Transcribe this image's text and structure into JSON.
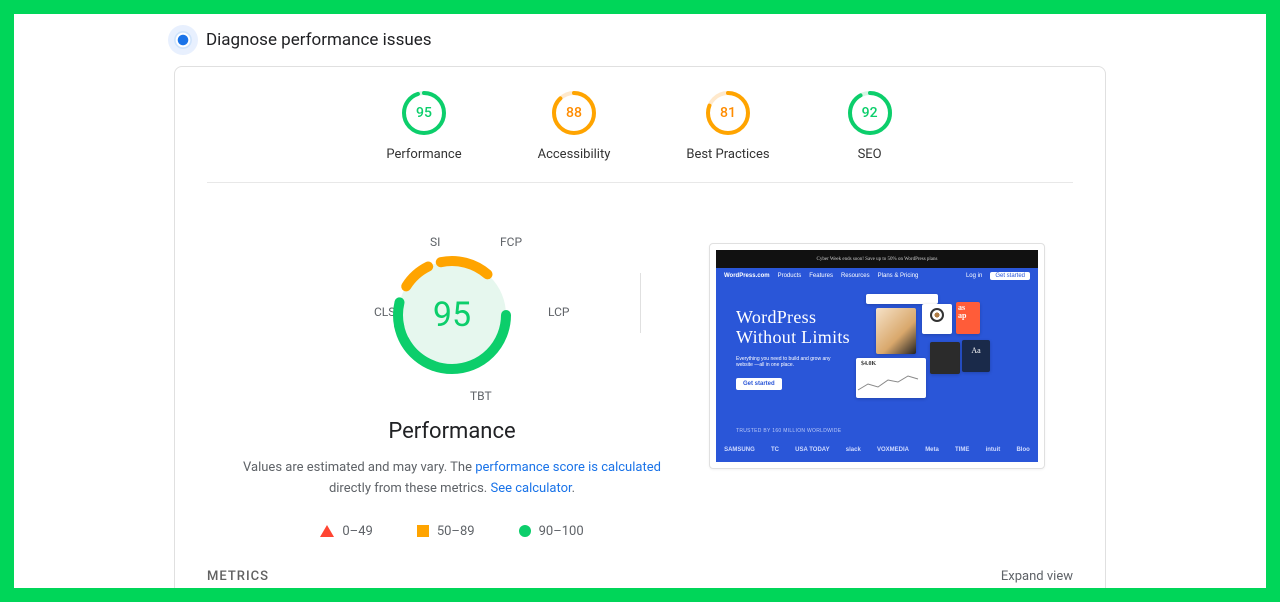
{
  "heading": "Diagnose performance issues",
  "gauges": {
    "performance": {
      "score": "95",
      "label": "Performance"
    },
    "accessibility": {
      "score": "88",
      "label": "Accessibility"
    },
    "bestpractices": {
      "score": "81",
      "label": "Best Practices"
    },
    "seo": {
      "score": "92",
      "label": "SEO"
    }
  },
  "big": {
    "score": "95",
    "title": "Performance",
    "segments": {
      "si": "SI",
      "fcp": "FCP",
      "lcp": "LCP",
      "tbt": "TBT",
      "cls": "CLS"
    }
  },
  "desc": {
    "prefix": "Values are estimated and may vary. The ",
    "link1": "performance score is calculated",
    "middle": " directly from these metrics. ",
    "link2": "See calculator",
    "suffix": "."
  },
  "legend": {
    "low": "0–49",
    "mid": "50–89",
    "high": "90–100"
  },
  "metrics": {
    "title": "METRICS",
    "expand": "Expand view"
  },
  "screenshot": {
    "banner": "Cyber Week ends soon! Save up to 50% on WordPress plans",
    "logo": "WordPress.com",
    "nav1": "Products",
    "nav2": "Features",
    "nav3": "Resources",
    "nav4": "Plans & Pricing",
    "login": "Log in",
    "cta": "Get started",
    "hero1": "WordPress",
    "hero2": "Without Limits",
    "sub": "Everything you need to build and grow any website —all in one place.",
    "heroCta": "Get started",
    "trust": "TRUSTED BY 160 MILLION WORLDWIDE",
    "brands": {
      "b1": "SAMSUNG",
      "b2": "TC",
      "b3": "USA TODAY",
      "b4": "slack",
      "b5": "VOXMEDIA",
      "b6": "Meta",
      "b7": "TIME",
      "b8": "intuit",
      "b9": "Bloo"
    }
  }
}
